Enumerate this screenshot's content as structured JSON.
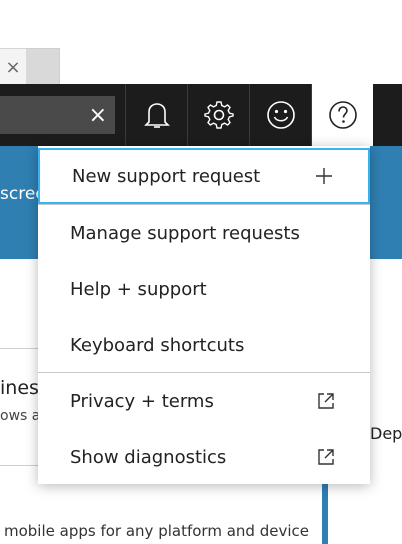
{
  "tabbar": {
    "close_glyph": "×"
  },
  "topbar": {
    "search_clear_glyph": "×",
    "icons": [
      "bell-icon",
      "gear-icon",
      "smiley-icon",
      "help-icon"
    ]
  },
  "background": {
    "banner_fragment": "screen",
    "left_fragment_1": "ines",
    "left_fragment_2": "ows ar",
    "right_fragment": "Dep",
    "bottom_text": "mobile apps for any platform and device"
  },
  "menu": {
    "items": [
      {
        "label": "New support request",
        "icon": "plus-icon"
      },
      {
        "label": "Manage support requests",
        "icon": ""
      },
      {
        "label": "Help + support",
        "icon": ""
      },
      {
        "label": "Keyboard shortcuts",
        "icon": ""
      },
      {
        "label": "Privacy + terms",
        "icon": "external-link-icon"
      },
      {
        "label": "Show diagnostics",
        "icon": "external-link-icon"
      }
    ]
  },
  "colors": {
    "topbar": "#1c1c1c",
    "banner": "#2f7fb2",
    "focus": "#36b3f0"
  }
}
